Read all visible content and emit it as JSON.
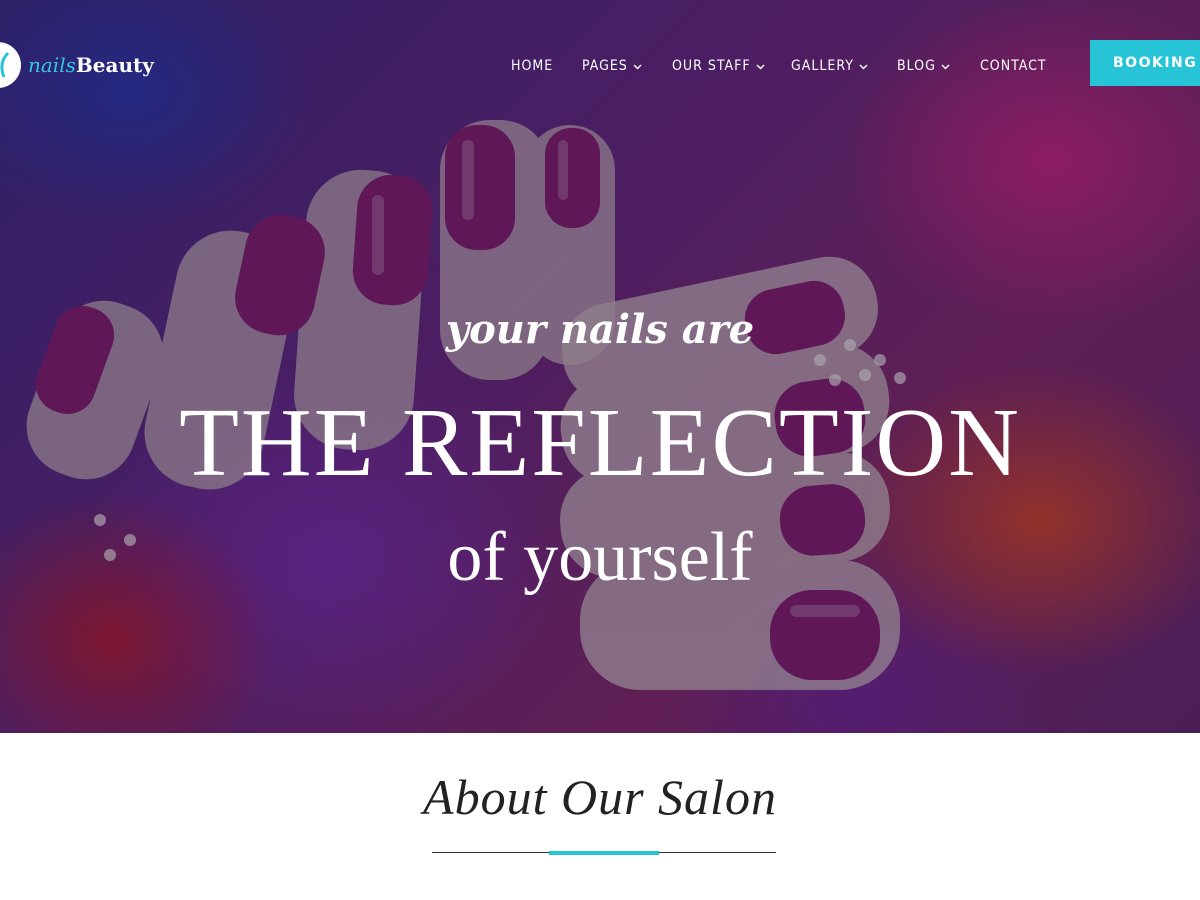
{
  "header": {
    "logo_part1": "nails",
    "logo_part2": "Beauty",
    "nav": [
      {
        "label": "HOME",
        "has_dropdown": false
      },
      {
        "label": "PAGES",
        "has_dropdown": true
      },
      {
        "label": "OUR STAFF",
        "has_dropdown": true
      },
      {
        "label": "GALLERY",
        "has_dropdown": true
      },
      {
        "label": "BLOG",
        "has_dropdown": true
      },
      {
        "label": "CONTACT",
        "has_dropdown": false
      }
    ],
    "booking_label": "BOOKING NOW"
  },
  "hero": {
    "tagline": "your nails are",
    "headline": "THE REFLECTION",
    "subline": "of yourself"
  },
  "about": {
    "title": "About Our Salon"
  },
  "colors": {
    "accent": "#27c4d8",
    "nail_polish": "#8a1f7a",
    "text_dark": "#222222"
  }
}
